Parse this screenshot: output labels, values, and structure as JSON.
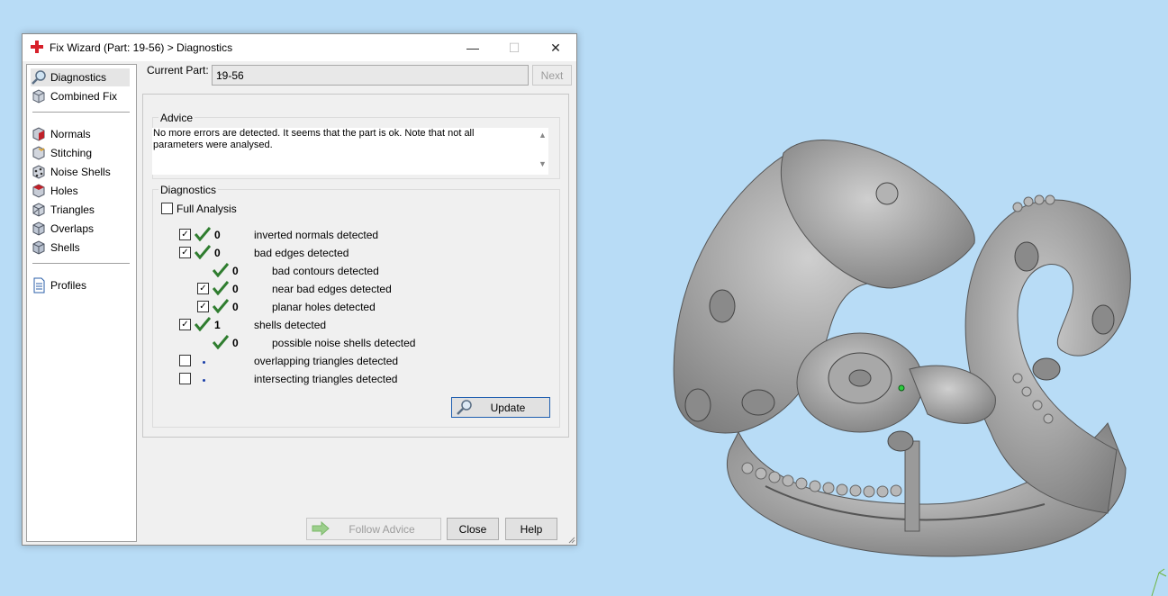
{
  "window": {
    "title": "Fix Wizard (Part: 19-56) > Diagnostics",
    "minimize": "—",
    "maximize": "☐",
    "close": "✕"
  },
  "sidebar": {
    "items": [
      {
        "label": "Diagnostics",
        "icon": "magnifier-icon"
      },
      {
        "label": "Combined Fix",
        "icon": "cube-icon"
      },
      {
        "label": "Normals",
        "icon": "normals-cube-icon"
      },
      {
        "label": "Stitching",
        "icon": "stitching-icon"
      },
      {
        "label": "Noise Shells",
        "icon": "noise-shells-icon"
      },
      {
        "label": "Holes",
        "icon": "holes-cube-icon"
      },
      {
        "label": "Triangles",
        "icon": "triangles-cube-icon"
      },
      {
        "label": "Overlaps",
        "icon": "overlaps-cube-icon"
      },
      {
        "label": "Shells",
        "icon": "shells-cube-icon"
      },
      {
        "label": "Profiles",
        "icon": "document-icon"
      }
    ]
  },
  "header": {
    "current_part_label": "Current Part:",
    "current_part_value": "19-56",
    "next_label": "Next"
  },
  "advice": {
    "title": "Advice",
    "text": "No more errors are detected. It seems that the part is ok. Note that not all parameters were analysed."
  },
  "diagnostics": {
    "title": "Diagnostics",
    "full_analysis_label": "Full Analysis",
    "rows": [
      {
        "checked": true,
        "status": "ok",
        "count": "0",
        "label": "inverted normals detected"
      },
      {
        "checked": true,
        "status": "ok",
        "count": "0",
        "label": "bad edges detected"
      },
      {
        "checked": null,
        "status": "ok",
        "count": "0",
        "label": "bad contours detected"
      },
      {
        "checked": true,
        "status": "ok",
        "count": "0",
        "label": "near bad edges detected"
      },
      {
        "checked": true,
        "status": "ok",
        "count": "0",
        "label": "planar holes detected"
      },
      {
        "checked": true,
        "status": "ok",
        "count": "1",
        "label": "shells detected"
      },
      {
        "checked": null,
        "status": "ok",
        "count": "0",
        "label": "possible noise shells detected"
      },
      {
        "checked": false,
        "status": "pending",
        "count": "",
        "label": "overlapping triangles detected"
      },
      {
        "checked": false,
        "status": "pending",
        "count": "",
        "label": "intersecting triangles detected"
      }
    ],
    "update_label": "Update"
  },
  "footer": {
    "follow_advice_label": "Follow Advice",
    "close_label": "Close",
    "help_label": "Help"
  },
  "colors": {
    "accent": "#2f7d2f",
    "viewport_bg": "#b8dcf6",
    "model": "#9a9a9a"
  }
}
